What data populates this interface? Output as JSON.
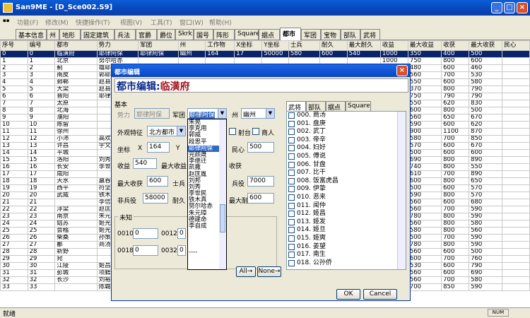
{
  "window": {
    "title": "San9ME - [D_Sce002.S9]"
  },
  "menu": [
    "功能(F)",
    "修改(M)",
    "快捷操作(T)",
    "视图(V)",
    "工具(T)",
    "窗口(W)",
    "帮助(H)"
  ],
  "tabs": [
    "基本信息",
    "州",
    "地形",
    "固定建筑",
    "兵法",
    "官爵",
    "爵位",
    "Skrk",
    "国号",
    "阵形",
    "Square",
    "据点",
    "都市",
    "军团",
    "宝物",
    "部队",
    "武将"
  ],
  "active_tab": "都市",
  "grid": {
    "headers": [
      "序号",
      "编号",
      "都市",
      "势力",
      "军团",
      "州",
      "工作物",
      "X坐标",
      "Y坐标",
      "士兵",
      "耐久",
      "最大耐久",
      "收益",
      "最大收益",
      "收获",
      "最大收获",
      "民心"
    ],
    "rows": [
      [
        "0",
        "0",
        "临潢府",
        "耶律阿保",
        "耶律阿保",
        "幽州",
        "164",
        "17",
        "50000",
        "580",
        "600",
        "540",
        "1000",
        "350",
        "400",
        "500"
      ],
      [
        "1",
        "1",
        "北京",
        "努尔哈赤",
        "",
        "",
        "",
        "",
        "",
        "",
        "",
        "",
        "1000",
        "750",
        "800",
        "600"
      ],
      [
        "2",
        "2",
        "蓟",
        "雄耶",
        "",
        "",
        "",
        "",
        "",
        "",
        "",
        "",
        "1000",
        "480",
        "600",
        "460"
      ],
      [
        "3",
        "3",
        "南皮",
        "郭耶",
        "",
        "",
        "",
        "",
        "",
        "",
        "",
        "",
        "1000",
        "560",
        "700",
        "530"
      ],
      [
        "4",
        "4",
        "邺郸",
        "赵县",
        "",
        "",
        "",
        "",
        "",
        "",
        "",
        "",
        "1000",
        "550",
        "600",
        "580"
      ],
      [
        "5",
        "5",
        "大梁",
        "赵县",
        "",
        "",
        "",
        "",
        "",
        "",
        "",
        "",
        "1000",
        "370",
        "800",
        "790"
      ],
      [
        "6",
        "6",
        "晋阳",
        "耶律",
        "",
        "",
        "",
        "",
        "",
        "",
        "",
        "",
        "1000",
        "750",
        "790",
        "790"
      ],
      [
        "7",
        "7",
        "太原",
        "",
        "",
        "",
        "",
        "",
        "",
        "",
        "",
        "",
        "1000",
        "550",
        "620",
        "830"
      ],
      [
        "8",
        "8",
        "北海",
        "",
        "",
        "",
        "",
        "",
        "",
        "",
        "",
        "",
        "1000",
        "600",
        "800",
        "500"
      ],
      [
        "9",
        "9",
        "濮阳",
        "",
        "",
        "",
        "",
        "",
        "",
        "",
        "",
        "",
        "1000",
        "560",
        "650",
        "670"
      ],
      [
        "10",
        "10",
        "陈留",
        "",
        "",
        "",
        "",
        "",
        "",
        "",
        "",
        "",
        "1000",
        "590",
        "600",
        "620"
      ],
      [
        "11",
        "11",
        "徐州",
        "",
        "",
        "",
        "",
        "",
        "",
        "",
        "",
        "",
        "1000",
        "900",
        "1100",
        "870"
      ],
      [
        "12",
        "12",
        "小沛",
        "高欢",
        "",
        "",
        "",
        "",
        "",
        "",
        "",
        "",
        "1000",
        "580",
        "700",
        "850"
      ],
      [
        "13",
        "13",
        "许昌",
        "宇文",
        "",
        "",
        "",
        "",
        "",
        "",
        "",
        "",
        "1000",
        "570",
        "600",
        "670"
      ],
      [
        "14",
        "14",
        "平城",
        "",
        "",
        "",
        "",
        "",
        "",
        "",
        "",
        "",
        "1000",
        "500",
        "600",
        "600"
      ],
      [
        "15",
        "15",
        "洛阳",
        "刘秀",
        "",
        "",
        "",
        "",
        "",
        "",
        "",
        "",
        "1000",
        "690",
        "800",
        "890"
      ],
      [
        "16",
        "16",
        "长安",
        "李世",
        "",
        "",
        "",
        "",
        "",
        "",
        "",
        "",
        "1000",
        "740",
        "800",
        "550"
      ],
      [
        "17",
        "17",
        "咸阳",
        "",
        "",
        "",
        "",
        "",
        "",
        "",
        "",
        "",
        "1000",
        "610",
        "700",
        "890"
      ],
      [
        "18",
        "18",
        "天水",
        "赢吞",
        "",
        "",
        "",
        "",
        "",
        "",
        "",
        "",
        "1000",
        "600",
        "800",
        "650"
      ],
      [
        "19",
        "19",
        "西平",
        "符坚",
        "",
        "",
        "",
        "",
        "",
        "",
        "",
        "",
        "1000",
        "500",
        "600",
        "570"
      ],
      [
        "20",
        "20",
        "武威",
        "铁木",
        "",
        "",
        "",
        "",
        "",
        "",
        "",
        "",
        "1000",
        "590",
        "800",
        "570"
      ],
      [
        "21",
        "21",
        "",
        "李信",
        "",
        "",
        "",
        "",
        "",
        "",
        "",
        "",
        "1000",
        "560",
        "600",
        "680"
      ],
      [
        "22",
        "22",
        "浮梁",
        "赵匡",
        "",
        "",
        "",
        "",
        "",
        "",
        "",
        "",
        "1000",
        "560",
        "700",
        "590"
      ],
      [
        "23",
        "23",
        "南京",
        "朱元",
        "",
        "",
        "",
        "",
        "",
        "",
        "",
        "",
        "1000",
        "780",
        "800",
        "590"
      ],
      [
        "24",
        "24",
        "姑苏",
        "姬光",
        "",
        "",
        "",
        "",
        "",
        "",
        "",
        "",
        "1000",
        "560",
        "800",
        "580"
      ],
      [
        "25",
        "25",
        "会稽",
        "姬光",
        "",
        "",
        "",
        "",
        "",
        "",
        "",
        "",
        "1000",
        "580",
        "800",
        "560"
      ],
      [
        "26",
        "26",
        "柴桑",
        "孙策",
        "",
        "",
        "",
        "",
        "",
        "",
        "",
        "",
        "1000",
        "500",
        "700",
        "590"
      ],
      [
        "27",
        "27",
        "鄱",
        "商汤",
        "",
        "",
        "",
        "",
        "",
        "",
        "",
        "",
        "1000",
        "780",
        "800",
        "590"
      ],
      [
        "28",
        "28",
        "新野",
        "",
        "",
        "",
        "",
        "",
        "",
        "",
        "",
        "",
        "1000",
        "560",
        "600",
        "500"
      ],
      [
        "29",
        "29",
        "宛",
        "",
        "",
        "",
        "",
        "",
        "",
        "",
        "",
        "",
        "1000",
        "600",
        "700",
        "760"
      ],
      [
        "30",
        "30",
        "江陵",
        "姬昌",
        "",
        "",
        "",
        "",
        "",
        "",
        "",
        "",
        "1000",
        "530",
        "600",
        "790"
      ],
      [
        "31",
        "31",
        "彭城",
        "项籍",
        "",
        "",
        "",
        "",
        "",
        "",
        "",
        "",
        "1000",
        "560",
        "600",
        "690"
      ],
      [
        "32",
        "32",
        "长沙",
        "刘裕",
        "",
        "",
        "",
        "",
        "",
        "",
        "",
        "",
        "1000",
        "560",
        "700",
        "580"
      ],
      [
        "33",
        "33",
        "",
        "陈霸",
        "",
        "",
        "",
        "",
        "",
        "",
        "",
        "",
        "1000",
        "700",
        "850",
        "590"
      ]
    ]
  },
  "status": {
    "text": "就绪",
    "indicator": "NUM"
  },
  "dialog": {
    "title": "都市编辑",
    "heading_label": "都市编辑:",
    "heading_city": "临潢府",
    "basic_label": "基本",
    "force_label": "势力",
    "force_value": "耶律阿保",
    "corps_label": "军团",
    "corps_value": "耶律阿保",
    "state_label": "州",
    "state_value": "幽州",
    "fixed_label": "外观特征",
    "fixed_value": "北方都市",
    "checks": [
      "射台",
      "商人"
    ],
    "coord_label": "坐标",
    "x_label": "X",
    "x_value": "164",
    "y_label": "Y",
    "people_label": "民心",
    "people_value": "500",
    "income_label": "收益",
    "income_value": "540",
    "maxincome_label": "最大收益",
    "harvest_label": "收获",
    "maxharvest_label": "最大收获",
    "maxharvest_value": "600",
    "soldier_label": "士兵",
    "service_label": "兵役",
    "service_value": "7000",
    "troops_label": "非兵役",
    "troops_value": "58000",
    "dur_label": "耐久",
    "maxdur_label": "最大耐久",
    "maxdur_value": "600",
    "unknown_label": "未知",
    "unk": [
      {
        "label": "0010",
        "value": "0"
      },
      {
        "label": "0012",
        "value": "0"
      },
      {
        "label": "0018",
        "value": "0"
      },
      {
        "label": "0032",
        "value": "0"
      }
    ],
    "dropdown": [
      "朱晃",
      "李克用",
      "郭威",
      "段思平",
      "耶律阿保",
      "完颜晟",
      "李继迁",
      "凯撒",
      "赵匡胤",
      "刘邦",
      "刘秀",
      "李世民",
      "铁木真",
      "努尔哈赤",
      "朱元璋",
      "德建命",
      "李自成",
      "",
      "",
      "",
      "----"
    ],
    "dropdown_selected": "耶律阿保",
    "right_tabs": [
      "武将",
      "部队",
      "据点",
      "Square"
    ],
    "generals": [
      "000. 商汤",
      "001. 盘庚",
      "002. 武丁",
      "003. 帝辛",
      "004. 妇好",
      "005. 傅说",
      "006. 甘盘",
      "007. 比干",
      "008. 饭富虎昌",
      "009. 伊挚",
      "010. 恶来",
      "011. 闻仲",
      "012. 姬昌",
      "013. 姬发",
      "014. 姬旦",
      "015. 姬奭",
      "016. 姜望",
      "017. 南生",
      "018. 公孙侨"
    ],
    "btn_all": "All→",
    "btn_none": "None→",
    "btn_ok": "OK",
    "btn_cancel": "Cancel"
  }
}
